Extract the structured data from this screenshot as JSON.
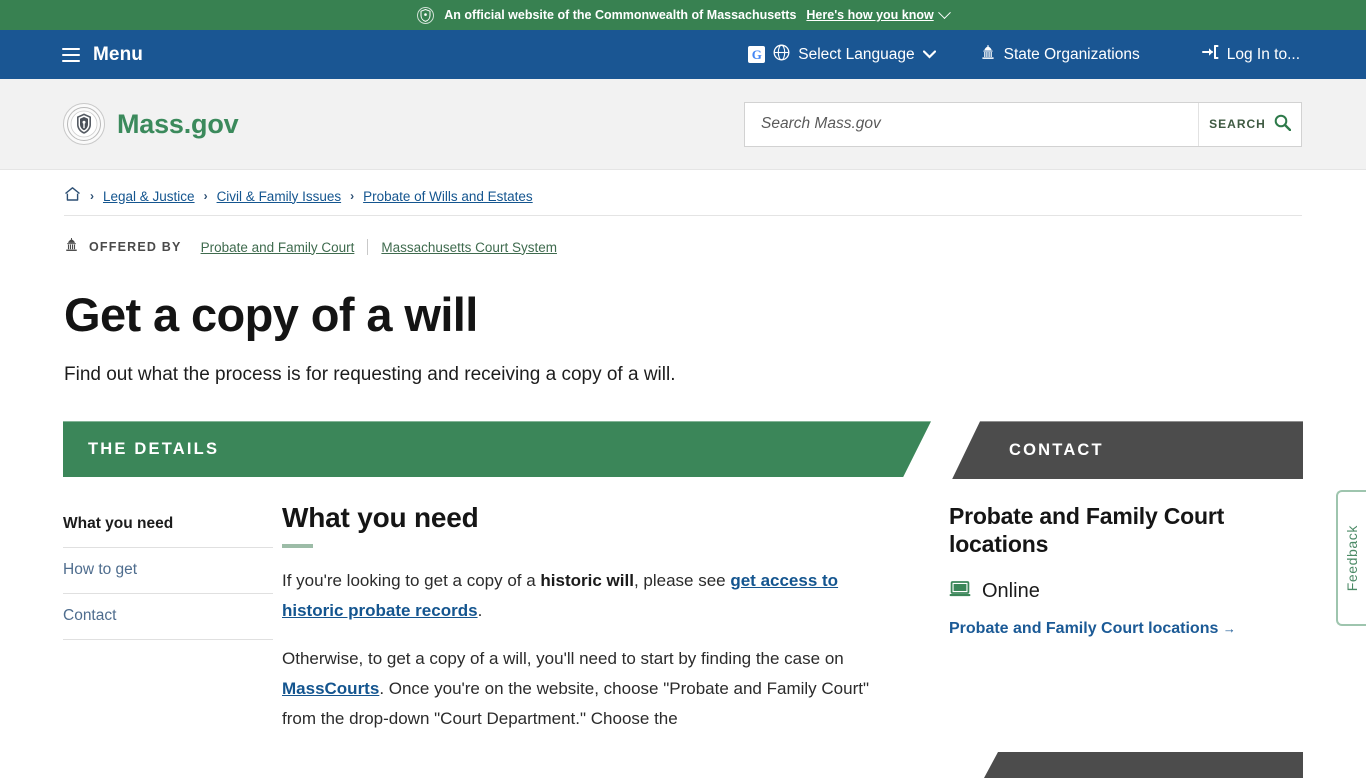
{
  "gov_banner": {
    "seal_icon": "state-seal-icon",
    "text": "An official website of the Commonwealth of Massachusetts",
    "how_you_know": "Here's how you know",
    "chevron_icon": "chevron-down-icon",
    "bg_color": "#388151"
  },
  "utility_nav": {
    "menu_icon": "hamburger-icon",
    "menu_label": "Menu",
    "bg_color": "#1a5693",
    "items": [
      {
        "label": "Select Language",
        "icon": "globe-icon",
        "extra_icon": "google-translate-icon",
        "chevron": "chevron-down-icon"
      },
      {
        "label": "State Organizations",
        "icon": "capitol-building-icon"
      },
      {
        "label": "Log In to...",
        "icon": "login-arrow-icon"
      }
    ]
  },
  "header": {
    "seal_icon": "mass-state-seal-icon",
    "brand": "Mass.gov",
    "brand_color": "#3b8a5c",
    "search": {
      "placeholder": "Search Mass.gov",
      "value": "",
      "button_label": "SEARCH",
      "button_icon": "magnifier-icon"
    }
  },
  "breadcrumb": {
    "home_icon": "home-icon",
    "separator": "›",
    "items": [
      {
        "label": "Legal & Justice"
      },
      {
        "label": "Civil & Family Issues"
      },
      {
        "label": "Probate of Wills and Estates"
      }
    ]
  },
  "offered_by": {
    "icon": "capitol-building-icon",
    "label": "OFFERED BY",
    "links": [
      {
        "label": "Probate and Family Court"
      },
      {
        "label": "Massachusetts Court System"
      }
    ]
  },
  "page": {
    "title": "Get a copy of a will",
    "subtitle": "Find out what the process is for requesting and receiving a copy of a will."
  },
  "banners": {
    "details": {
      "label": "THE DETAILS",
      "color": "#3b8659"
    },
    "contact": {
      "label": "CONTACT",
      "color": "#4c4c4c"
    }
  },
  "side_nav": {
    "items": [
      {
        "label": "What you need",
        "active": true
      },
      {
        "label": "How to get",
        "active": false
      },
      {
        "label": "Contact",
        "active": false
      }
    ]
  },
  "main": {
    "heading": "What you need",
    "paragraph1": {
      "part1": "If you're looking to get a copy of a ",
      "bold1": "historic will",
      "part2": ", please see ",
      "link1": "get access to historic probate records",
      "part3": "."
    },
    "paragraph2": {
      "part1": "Otherwise, to get a copy of a will, you'll need to start by finding the case on ",
      "link1": "MassCourts",
      "part2": ". Once you're on the website, choose \"Probate and Family Court\" from the drop-down \"Court Department.\" Choose the"
    }
  },
  "contact_panel": {
    "title": "Probate and Family Court locations",
    "method": {
      "icon": "laptop-icon",
      "label": "Online"
    },
    "link": "Probate and Family Court locations",
    "link_arrow": "→"
  },
  "feedback": {
    "label": "Feedback",
    "border_color": "#9ec5ae",
    "text_color": "#4b8a66"
  }
}
